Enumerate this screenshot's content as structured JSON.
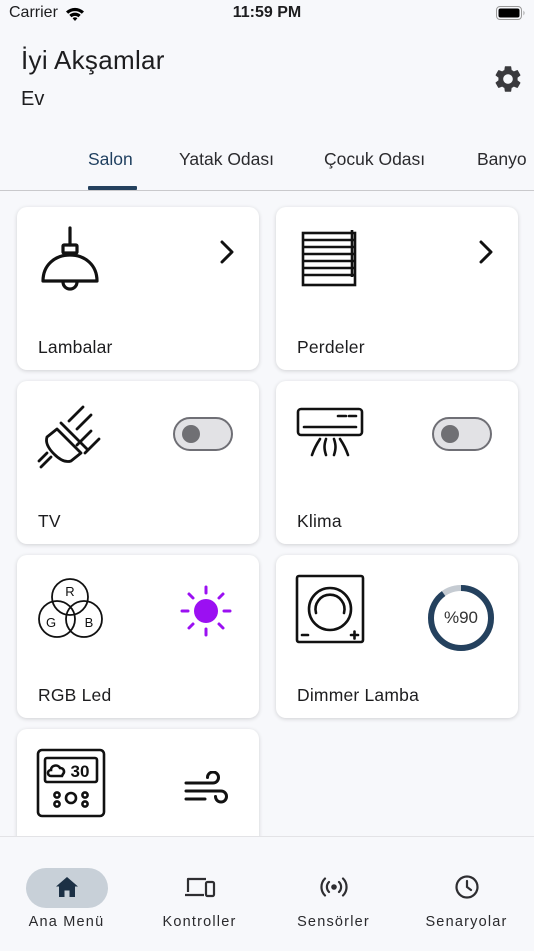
{
  "status_bar": {
    "carrier": "Carrier",
    "time": "11:59 PM"
  },
  "header": {
    "greeting": "İyi Akşamlar",
    "home": "Ev"
  },
  "tabs": [
    {
      "label": "Salon",
      "active": true
    },
    {
      "label": "Yatak Odası",
      "active": false
    },
    {
      "label": "Çocuk Odası",
      "active": false
    },
    {
      "label": "Banyo",
      "active": false
    }
  ],
  "cards": [
    {
      "label": "Lambalar",
      "icon": "pendant-lamp-icon",
      "control": "chevron"
    },
    {
      "label": "Perdeler",
      "icon": "blinds-icon",
      "control": "chevron"
    },
    {
      "label": "TV",
      "icon": "plug-icon",
      "control": "toggle",
      "state": "off"
    },
    {
      "label": "Klima",
      "icon": "air-conditioner-icon",
      "control": "toggle",
      "state": "off"
    },
    {
      "label": "RGB Led",
      "icon": "rgb-circles-icon",
      "control": "sun",
      "color": "#9b10f2"
    },
    {
      "label": "Dimmer Lamba",
      "icon": "dimmer-icon",
      "control": "ring",
      "value_text": "%90",
      "value": 90
    },
    {
      "label": "",
      "icon": "thermostat-icon",
      "control": "wind"
    }
  ],
  "rgb_letters": {
    "r": "R",
    "g": "G",
    "b": "B"
  },
  "thermostat": {
    "display": "30"
  },
  "bottom_nav": [
    {
      "label": "Ana Menü",
      "icon": "home-icon",
      "active": true
    },
    {
      "label": "Kontroller",
      "icon": "devices-icon",
      "active": false
    },
    {
      "label": "Sensörler",
      "icon": "sensor-icon",
      "active": false
    },
    {
      "label": "Senaryolar",
      "icon": "clock-icon",
      "active": false
    }
  ],
  "colors": {
    "accent": "#24415e",
    "rgb_sun": "#9b10f2",
    "ring_track": "#c5cbd2",
    "nav_pill": "#c8d0d8"
  }
}
